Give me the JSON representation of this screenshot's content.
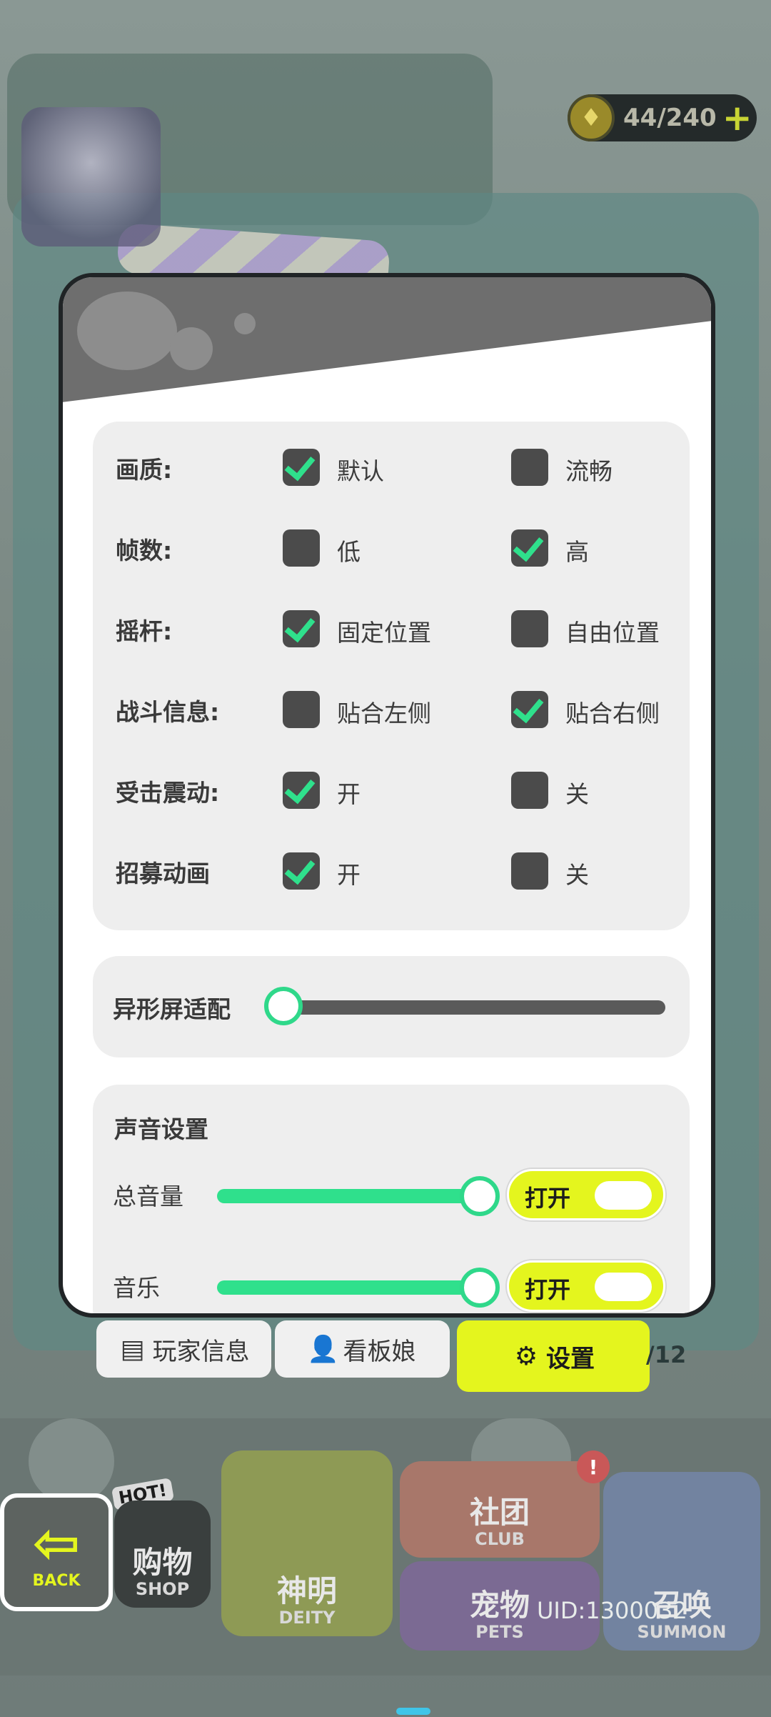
{
  "currency": {
    "value": "44/240",
    "plus": "+"
  },
  "settings": {
    "options": [
      {
        "label": "画质:",
        "a": {
          "text": "默认",
          "checked": true
        },
        "b": {
          "text": "流畅",
          "checked": false
        }
      },
      {
        "label": "帧数:",
        "a": {
          "text": "低",
          "checked": false
        },
        "b": {
          "text": "高",
          "checked": true
        }
      },
      {
        "label": "摇杆:",
        "a": {
          "text": "固定位置",
          "checked": true
        },
        "b": {
          "text": "自由位置",
          "checked": false
        }
      },
      {
        "label": "战斗信息:",
        "a": {
          "text": "贴合左侧",
          "checked": false
        },
        "b": {
          "text": "贴合右侧",
          "checked": true
        }
      },
      {
        "label": "受击震动:",
        "a": {
          "text": "开",
          "checked": true
        },
        "b": {
          "text": "关",
          "checked": false
        }
      },
      {
        "label": "招募动画",
        "a": {
          "text": "开",
          "checked": true
        },
        "b": {
          "text": "关",
          "checked": false
        }
      }
    ],
    "notch": {
      "label": "异形屏适配",
      "value": 0
    },
    "sound": {
      "title": "声音设置",
      "rows": [
        {
          "label": "总音量",
          "level": 1.0,
          "toggle": "打开"
        },
        {
          "label": "音乐",
          "level": 1.0,
          "toggle": "打开"
        }
      ]
    }
  },
  "tabs": {
    "player_info": "玩家信息",
    "mascot": "看板娘",
    "settings": "设置",
    "page_count": "/12"
  },
  "nav": {
    "back": "BACK",
    "hot": "HOT!",
    "shop_cn": "购物",
    "shop_en": "SHOP",
    "deity_cn": "神明",
    "deity_en": "DEITY",
    "club_cn": "社团",
    "club_en": "CLUB",
    "pets_cn": "宠物",
    "pets_en": "PETS",
    "summon_cn": "召唤",
    "summon_en": "SUMMON",
    "club_alert": "!"
  },
  "uid": "UID:1300032",
  "colors": {
    "accent": "#e4f51e",
    "check": "#2fe08c",
    "modal_border": "#202426"
  }
}
